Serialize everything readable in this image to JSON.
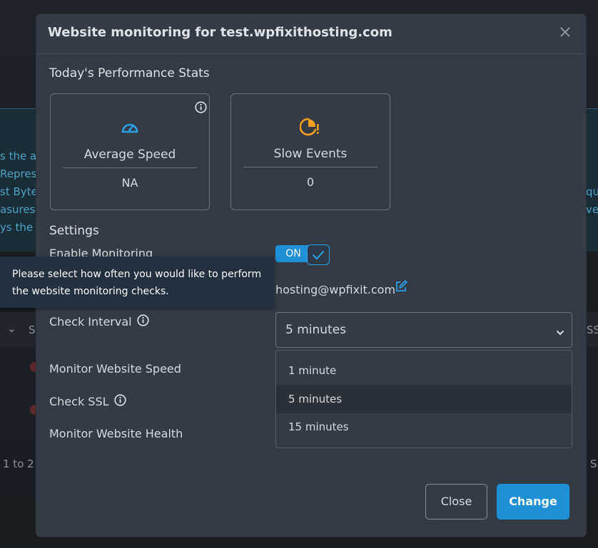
{
  "background": {
    "left_fragments": [
      "s the a",
      "Represe",
      "st Byte",
      "asures",
      "ys the m"
    ],
    "right_fragments": [
      "qu",
      "ve"
    ],
    "table_col_left": "S",
    "table_col_right": "SS",
    "pagination_left": "1 to 2",
    "pagination_right": "S"
  },
  "modal": {
    "title": "Website monitoring for test.wpfixithosting.com",
    "stats_heading": "Today's Performance Stats",
    "stats": [
      {
        "label": "Average Speed",
        "value": "NA",
        "icon": "speedometer-icon"
      },
      {
        "label": "Slow Events",
        "value": "0",
        "icon": "slow-clock-alert-icon"
      }
    ],
    "settings_heading": "Settings",
    "enable_monitoring_label": "Enable Monitoring",
    "toggle_state": "ON",
    "email": "hosting@wpfixit.com",
    "check_interval_label": "Check Interval",
    "check_interval_value": "5 minutes",
    "interval_options": [
      "1 minute",
      "5 minutes",
      "15 minutes"
    ],
    "monitor_speed_label": "Monitor Website Speed",
    "check_ssl_label": "Check SSL",
    "monitor_health_label": "Monitor Website Health",
    "close_button": "Close",
    "change_button": "Change"
  },
  "tooltip": {
    "text": "Please select how often you would like to perform the website monitoring checks."
  },
  "colors": {
    "accent": "#1f8fd6",
    "speed_icon": "#2aa0e8",
    "slow_icon": "#f0a020",
    "modal_bg": "#353b45"
  }
}
